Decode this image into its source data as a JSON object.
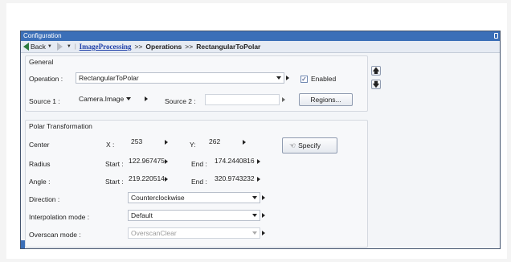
{
  "window": {
    "title": "Configuration"
  },
  "nav": {
    "back_label": "Back",
    "breadcrumb_link": "ImageProcessing",
    "crumb_separator": ">>",
    "crumb_operations": "Operations",
    "crumb_current": "RectangularToPolar"
  },
  "general": {
    "title": "General",
    "operation_label": "Operation :",
    "operation_value": "RectangularToPolar",
    "enabled_label": "Enabled",
    "enabled_checked": true,
    "source1_label": "Source 1 :",
    "source1_value": "Camera.Image",
    "source2_label": "Source 2 :",
    "source2_value": "",
    "regions_button": "Regions..."
  },
  "polar": {
    "title": "Polar Transformation",
    "center_label": "Center",
    "x_label": "X :",
    "x_value": "253",
    "y_label": "Y:",
    "y_value": "262",
    "specify_button": "Specify",
    "radius_label": "Radius",
    "radius_start_label": "Start :",
    "radius_start_value": "122.9674753",
    "radius_end_label": "End :",
    "radius_end_value": "174.2440816",
    "angle_label": "Angle :",
    "angle_start_label": "Start :",
    "angle_start_value": "219.2205141",
    "angle_end_label": "End :",
    "angle_end_value": "320.9743232",
    "direction_label": "Direction :",
    "direction_value": "Counterclockwise",
    "interpolation_label": "Interpolation mode :",
    "interpolation_value": "Default",
    "overscan_label": "Overscan mode :",
    "overscan_value": "OverscanClear"
  },
  "icons": {
    "up": "arrow-up-icon",
    "down": "arrow-down-icon",
    "specify": "pointer-hand-icon",
    "back": "back-arrow-icon",
    "forward": "forward-arrow-icon"
  },
  "colors": {
    "titlebar": "#3b6fb8",
    "link": "#1e3fa8",
    "back_arrow": "#2c7a3f"
  }
}
